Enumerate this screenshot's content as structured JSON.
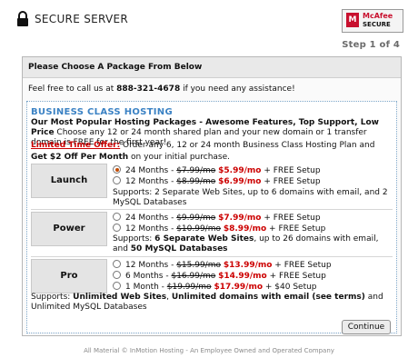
{
  "header": {
    "title": "SECURE SERVER",
    "badge_brand": "McAfee",
    "badge_sub": "SECURE",
    "step": "Step 1 of 4"
  },
  "panel": {
    "heading": "Please Choose A Package From Below",
    "call_prefix": "Feel free to call us at ",
    "phone": "888-321-4678",
    "call_suffix": " if you need any assistance!"
  },
  "intro": {
    "section_title": "BUSINESS CLASS HOSTING",
    "bold_line": "Our Most Popular Hosting Packages - Awesome Features, Top Support, Low Price",
    "rest_line": " Choose any 12 or 24 month shared plan and your new domain or 1 transfer domain is FREE for the first year!",
    "offer_label": "Limited Time Offer:",
    "offer_text1": " Order any 6, 12 or 24 month Business Class Hosting Plan and ",
    "offer_bold": "Get $2 Off Per Month",
    "offer_text2": " on your initial purchase."
  },
  "packages": {
    "launch": {
      "label": "Launch",
      "opt1": {
        "term": "24 Months - ",
        "old": "$7.99/mo",
        "new": "$5.99/mo",
        "setup": " + FREE Setup"
      },
      "opt2": {
        "term": "12 Months - ",
        "old": "$8.99/mo",
        "new": "$6.99/mo",
        "setup": " + FREE Setup"
      },
      "supports": "Supports: 2 Separate Web Sites, up to 6 domains with email, and 2 MySQL Databases"
    },
    "power": {
      "label": "Power",
      "opt1": {
        "term": "24 Months - ",
        "old": "$9.99/mo",
        "new": "$7.99/mo",
        "setup": " + FREE Setup"
      },
      "opt2": {
        "term": "12 Months - ",
        "old": "$10.99/mo",
        "new": "$8.99/mo",
        "setup": " + FREE Setup"
      },
      "supports_prefix": "Supports: ",
      "supports_b1": "6 Separate Web Sites",
      "supports_mid": ", up to 26 domains with email, and ",
      "supports_b2": "50 MySQL Databases"
    },
    "pro": {
      "label": "Pro",
      "opt1": {
        "term": "12 Months - ",
        "old": "$15.99/mo",
        "new": "$13.99/mo",
        "setup": " + FREE Setup"
      },
      "opt2": {
        "term": "6 Months - ",
        "old": "$16.99/mo",
        "new": "$14.99/mo",
        "setup": " + FREE Setup"
      },
      "opt3": {
        "term": "1 Month - ",
        "old": "$19.99/mo",
        "new": "$17.99/mo",
        "setup": " + $40 Setup"
      },
      "supports_prefix": "Supports: ",
      "supports_b1": "Unlimited Web Sites",
      "supports_mid": ", ",
      "supports_b2": "Unlimited domains with email (see terms)",
      "supports_end": " and Unlimited MySQL Databases"
    }
  },
  "continue_label": "Continue",
  "footer": "All Material © InMotion Hosting - An Employee Owned and Operated Company"
}
